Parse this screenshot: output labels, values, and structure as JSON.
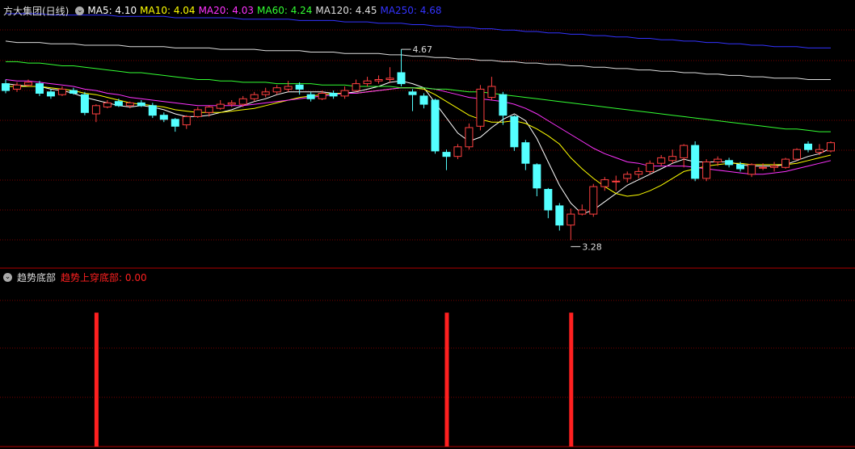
{
  "header": {
    "stock_name": "方大集团(日线)",
    "ma_labels": [
      {
        "text": "MA5: 4.10",
        "color": "#ffffff"
      },
      {
        "text": "MA10: 4.04",
        "color": "#ffff00"
      },
      {
        "text": "MA20: 4.03",
        "color": "#ff33ff"
      },
      {
        "text": "MA60: 4.24",
        "color": "#33ff33"
      },
      {
        "text": "MA120: 4.45",
        "color": "#dddddd"
      },
      {
        "text": "MA250: 4.68",
        "color": "#3333ff"
      }
    ]
  },
  "indicator": {
    "name": "趋势底部",
    "value_label": "趋势上穿底部: 0.00",
    "color": "#ff2020"
  },
  "colors": {
    "up": "#ff4040",
    "down": "#54ffff",
    "grid": "#7a0000",
    "divider": "#b00000"
  },
  "chart_data": [
    {
      "type": "candlestick",
      "title": "方大集团(日线)",
      "ylim": [
        3.1,
        4.9
      ],
      "high_marker": {
        "index": 35,
        "label": "4.67",
        "value": 4.67
      },
      "low_marker": {
        "index": 50,
        "label": "3.28",
        "value": 3.28
      },
      "candles": [
        {
          "o": 4.42,
          "c": 4.37,
          "h": 4.45,
          "l": 4.35
        },
        {
          "o": 4.38,
          "c": 4.41,
          "h": 4.43,
          "l": 4.36
        },
        {
          "o": 4.41,
          "c": 4.43,
          "h": 4.45,
          "l": 4.4
        },
        {
          "o": 4.42,
          "c": 4.35,
          "h": 4.44,
          "l": 4.33
        },
        {
          "o": 4.36,
          "c": 4.33,
          "h": 4.38,
          "l": 4.31
        },
        {
          "o": 4.34,
          "c": 4.38,
          "h": 4.4,
          "l": 4.33
        },
        {
          "o": 4.37,
          "c": 4.35,
          "h": 4.39,
          "l": 4.34
        },
        {
          "o": 4.34,
          "c": 4.21,
          "h": 4.36,
          "l": 4.19
        },
        {
          "o": 4.2,
          "c": 4.26,
          "h": 4.27,
          "l": 4.14
        },
        {
          "o": 4.25,
          "c": 4.28,
          "h": 4.3,
          "l": 4.24
        },
        {
          "o": 4.29,
          "c": 4.26,
          "h": 4.31,
          "l": 4.25
        },
        {
          "o": 4.26,
          "c": 4.28,
          "h": 4.29,
          "l": 4.24
        },
        {
          "o": 4.28,
          "c": 4.26,
          "h": 4.3,
          "l": 4.25
        },
        {
          "o": 4.26,
          "c": 4.19,
          "h": 4.28,
          "l": 4.17
        },
        {
          "o": 4.19,
          "c": 4.16,
          "h": 4.21,
          "l": 4.14
        },
        {
          "o": 4.16,
          "c": 4.11,
          "h": 4.17,
          "l": 4.07
        },
        {
          "o": 4.12,
          "c": 4.18,
          "h": 4.19,
          "l": 4.09
        },
        {
          "o": 4.18,
          "c": 4.23,
          "h": 4.25,
          "l": 4.17
        },
        {
          "o": 4.21,
          "c": 4.25,
          "h": 4.26,
          "l": 4.18
        },
        {
          "o": 4.24,
          "c": 4.27,
          "h": 4.3,
          "l": 4.23
        },
        {
          "o": 4.27,
          "c": 4.28,
          "h": 4.3,
          "l": 4.25
        },
        {
          "o": 4.27,
          "c": 4.31,
          "h": 4.33,
          "l": 4.25
        },
        {
          "o": 4.31,
          "c": 4.34,
          "h": 4.36,
          "l": 4.29
        },
        {
          "o": 4.34,
          "c": 4.36,
          "h": 4.39,
          "l": 4.32
        },
        {
          "o": 4.36,
          "c": 4.39,
          "h": 4.41,
          "l": 4.34
        },
        {
          "o": 4.38,
          "c": 4.4,
          "h": 4.44,
          "l": 4.36
        },
        {
          "o": 4.41,
          "c": 4.38,
          "h": 4.43,
          "l": 4.34
        },
        {
          "o": 4.34,
          "c": 4.31,
          "h": 4.36,
          "l": 4.29
        },
        {
          "o": 4.31,
          "c": 4.35,
          "h": 4.37,
          "l": 4.3
        },
        {
          "o": 4.35,
          "c": 4.33,
          "h": 4.37,
          "l": 4.31
        },
        {
          "o": 4.33,
          "c": 4.37,
          "h": 4.4,
          "l": 4.31
        },
        {
          "o": 4.37,
          "c": 4.42,
          "h": 4.45,
          "l": 4.36
        },
        {
          "o": 4.42,
          "c": 4.44,
          "h": 4.47,
          "l": 4.4
        },
        {
          "o": 4.44,
          "c": 4.45,
          "h": 4.48,
          "l": 4.42
        },
        {
          "o": 4.45,
          "c": 4.46,
          "h": 4.54,
          "l": 4.43
        },
        {
          "o": 4.5,
          "c": 4.42,
          "h": 4.67,
          "l": 4.4
        },
        {
          "o": 4.36,
          "c": 4.34,
          "h": 4.38,
          "l": 4.22
        },
        {
          "o": 4.33,
          "c": 4.27,
          "h": 4.35,
          "l": 4.24
        },
        {
          "o": 4.3,
          "c": 3.93,
          "h": 4.31,
          "l": 3.91
        },
        {
          "o": 3.92,
          "c": 3.89,
          "h": 3.94,
          "l": 3.79
        },
        {
          "o": 3.89,
          "c": 3.96,
          "h": 3.98,
          "l": 3.87
        },
        {
          "o": 3.96,
          "c": 4.1,
          "h": 4.13,
          "l": 3.94
        },
        {
          "o": 4.11,
          "c": 4.38,
          "h": 4.41,
          "l": 4.08
        },
        {
          "o": 4.32,
          "c": 4.4,
          "h": 4.47,
          "l": 4.3
        },
        {
          "o": 4.34,
          "c": 4.19,
          "h": 4.36,
          "l": 4.12
        },
        {
          "o": 4.18,
          "c": 3.96,
          "h": 4.19,
          "l": 3.93
        },
        {
          "o": 3.99,
          "c": 3.84,
          "h": 4.01,
          "l": 3.79
        },
        {
          "o": 3.83,
          "c": 3.66,
          "h": 3.84,
          "l": 3.6
        },
        {
          "o": 3.65,
          "c": 3.5,
          "h": 3.66,
          "l": 3.44
        },
        {
          "o": 3.53,
          "c": 3.39,
          "h": 3.55,
          "l": 3.35
        },
        {
          "o": 3.39,
          "c": 3.47,
          "h": 3.51,
          "l": 3.28
        },
        {
          "o": 3.47,
          "c": 3.5,
          "h": 3.54,
          "l": 3.46
        },
        {
          "o": 3.47,
          "c": 3.67,
          "h": 3.69,
          "l": 3.45
        },
        {
          "o": 3.67,
          "c": 3.72,
          "h": 3.74,
          "l": 3.64
        },
        {
          "o": 3.71,
          "c": 3.71,
          "h": 3.75,
          "l": 3.64
        },
        {
          "o": 3.73,
          "c": 3.76,
          "h": 3.78,
          "l": 3.7
        },
        {
          "o": 3.76,
          "c": 3.78,
          "h": 3.81,
          "l": 3.73
        },
        {
          "o": 3.78,
          "c": 3.84,
          "h": 3.86,
          "l": 3.76
        },
        {
          "o": 3.84,
          "c": 3.88,
          "h": 3.9,
          "l": 3.82
        },
        {
          "o": 3.86,
          "c": 3.89,
          "h": 3.94,
          "l": 3.84
        },
        {
          "o": 3.88,
          "c": 3.97,
          "h": 3.98,
          "l": 3.81
        },
        {
          "o": 3.97,
          "c": 3.73,
          "h": 4.0,
          "l": 3.71
        },
        {
          "o": 3.73,
          "c": 3.85,
          "h": 3.87,
          "l": 3.71
        },
        {
          "o": 3.85,
          "c": 3.87,
          "h": 3.89,
          "l": 3.82
        },
        {
          "o": 3.86,
          "c": 3.83,
          "h": 3.88,
          "l": 3.81
        },
        {
          "o": 3.83,
          "c": 3.8,
          "h": 3.85,
          "l": 3.78
        },
        {
          "o": 3.76,
          "c": 3.83,
          "h": 3.84,
          "l": 3.74
        },
        {
          "o": 3.81,
          "c": 3.81,
          "h": 3.84,
          "l": 3.79
        },
        {
          "o": 3.81,
          "c": 3.82,
          "h": 3.85,
          "l": 3.78
        },
        {
          "o": 3.81,
          "c": 3.87,
          "h": 3.88,
          "l": 3.8
        },
        {
          "o": 3.87,
          "c": 3.94,
          "h": 3.95,
          "l": 3.86
        },
        {
          "o": 3.98,
          "c": 3.94,
          "h": 4.0,
          "l": 3.92
        },
        {
          "o": 3.92,
          "c": 3.94,
          "h": 3.98,
          "l": 3.9
        },
        {
          "o": 3.93,
          "c": 3.99,
          "h": 4.0,
          "l": 3.92
        }
      ],
      "moving_averages": [
        {
          "name": "MA5",
          "color": "#ffffff",
          "values": [
            4.42,
            4.41,
            4.4,
            4.4,
            4.38,
            4.37,
            4.35,
            4.32,
            4.3,
            4.28,
            4.26,
            4.25,
            4.26,
            4.25,
            4.23,
            4.2,
            4.18,
            4.18,
            4.19,
            4.21,
            4.23,
            4.26,
            4.29,
            4.31,
            4.34,
            4.36,
            4.36,
            4.36,
            4.36,
            4.35,
            4.35,
            4.36,
            4.38,
            4.4,
            4.43,
            4.44,
            4.42,
            4.39,
            4.28,
            4.17,
            4.06,
            4.0,
            4.03,
            4.1,
            4.16,
            4.2,
            4.15,
            4.02,
            3.85,
            3.68,
            3.55,
            3.47,
            3.5,
            3.56,
            3.62,
            3.68,
            3.72,
            3.76,
            3.8,
            3.84,
            3.87,
            3.85,
            3.85,
            3.85,
            3.85,
            3.83,
            3.82,
            3.82,
            3.82,
            3.83,
            3.86,
            3.89,
            3.91,
            3.95
          ]
        },
        {
          "name": "MA10",
          "color": "#ffff00",
          "values": [
            4.4,
            4.4,
            4.4,
            4.4,
            4.39,
            4.38,
            4.37,
            4.35,
            4.34,
            4.32,
            4.3,
            4.28,
            4.27,
            4.26,
            4.25,
            4.23,
            4.22,
            4.21,
            4.21,
            4.21,
            4.22,
            4.23,
            4.24,
            4.26,
            4.28,
            4.3,
            4.32,
            4.33,
            4.34,
            4.35,
            4.35,
            4.35,
            4.36,
            4.37,
            4.38,
            4.39,
            4.39,
            4.38,
            4.34,
            4.29,
            4.24,
            4.19,
            4.16,
            4.14,
            4.14,
            4.15,
            4.13,
            4.09,
            4.04,
            3.98,
            3.88,
            3.8,
            3.73,
            3.67,
            3.62,
            3.6,
            3.61,
            3.64,
            3.68,
            3.73,
            3.78,
            3.8,
            3.82,
            3.83,
            3.84,
            3.84,
            3.83,
            3.83,
            3.83,
            3.83,
            3.84,
            3.86,
            3.88,
            3.9
          ]
        },
        {
          "name": "MA20",
          "color": "#ff33ff",
          "values": [
            4.45,
            4.44,
            4.44,
            4.43,
            4.42,
            4.41,
            4.4,
            4.38,
            4.37,
            4.35,
            4.34,
            4.32,
            4.31,
            4.3,
            4.29,
            4.28,
            4.27,
            4.26,
            4.26,
            4.26,
            4.26,
            4.26,
            4.27,
            4.28,
            4.29,
            4.3,
            4.31,
            4.32,
            4.33,
            4.34,
            4.35,
            4.35,
            4.36,
            4.37,
            4.38,
            4.39,
            4.39,
            4.39,
            4.38,
            4.36,
            4.34,
            4.32,
            4.31,
            4.3,
            4.29,
            4.27,
            4.24,
            4.2,
            4.15,
            4.1,
            4.05,
            4.0,
            3.95,
            3.91,
            3.88,
            3.85,
            3.84,
            3.82,
            3.82,
            3.82,
            3.82,
            3.81,
            3.8,
            3.79,
            3.78,
            3.77,
            3.76,
            3.76,
            3.77,
            3.78,
            3.8,
            3.82,
            3.84,
            3.86
          ]
        },
        {
          "name": "MA60",
          "color": "#33ff33",
          "values": [
            4.58,
            4.58,
            4.57,
            4.57,
            4.56,
            4.55,
            4.55,
            4.54,
            4.53,
            4.52,
            4.51,
            4.5,
            4.5,
            4.49,
            4.48,
            4.47,
            4.46,
            4.45,
            4.45,
            4.44,
            4.44,
            4.43,
            4.43,
            4.43,
            4.42,
            4.42,
            4.42,
            4.42,
            4.41,
            4.41,
            4.41,
            4.4,
            4.4,
            4.4,
            4.4,
            4.39,
            4.39,
            4.39,
            4.38,
            4.38,
            4.37,
            4.36,
            4.36,
            4.35,
            4.34,
            4.33,
            4.32,
            4.31,
            4.3,
            4.29,
            4.28,
            4.27,
            4.26,
            4.25,
            4.24,
            4.23,
            4.22,
            4.21,
            4.2,
            4.19,
            4.18,
            4.17,
            4.16,
            4.15,
            4.14,
            4.13,
            4.12,
            4.11,
            4.1,
            4.09,
            4.09,
            4.08,
            4.07,
            4.07
          ]
        },
        {
          "name": "MA120",
          "color": "#dddddd",
          "values": [
            4.73,
            4.72,
            4.72,
            4.72,
            4.71,
            4.71,
            4.71,
            4.7,
            4.7,
            4.7,
            4.7,
            4.69,
            4.69,
            4.69,
            4.69,
            4.68,
            4.68,
            4.68,
            4.68,
            4.67,
            4.67,
            4.67,
            4.67,
            4.66,
            4.66,
            4.66,
            4.66,
            4.65,
            4.65,
            4.65,
            4.64,
            4.64,
            4.64,
            4.64,
            4.63,
            4.63,
            4.62,
            4.62,
            4.61,
            4.61,
            4.6,
            4.6,
            4.59,
            4.59,
            4.58,
            4.58,
            4.57,
            4.57,
            4.56,
            4.56,
            4.55,
            4.55,
            4.54,
            4.54,
            4.53,
            4.53,
            4.52,
            4.52,
            4.51,
            4.51,
            4.5,
            4.5,
            4.49,
            4.49,
            4.48,
            4.48,
            4.47,
            4.47,
            4.46,
            4.46,
            4.46,
            4.45,
            4.45,
            4.45
          ]
        },
        {
          "name": "MA250",
          "color": "#3333ff",
          "values": [
            4.93,
            4.93,
            4.93,
            4.93,
            4.92,
            4.92,
            4.92,
            4.92,
            4.92,
            4.92,
            4.91,
            4.91,
            4.91,
            4.91,
            4.91,
            4.9,
            4.9,
            4.9,
            4.9,
            4.9,
            4.9,
            4.89,
            4.89,
            4.89,
            4.89,
            4.89,
            4.88,
            4.88,
            4.88,
            4.88,
            4.87,
            4.87,
            4.87,
            4.86,
            4.86,
            4.86,
            4.85,
            4.85,
            4.84,
            4.84,
            4.83,
            4.83,
            4.82,
            4.82,
            4.81,
            4.81,
            4.8,
            4.8,
            4.79,
            4.79,
            4.78,
            4.78,
            4.77,
            4.77,
            4.76,
            4.76,
            4.75,
            4.75,
            4.74,
            4.74,
            4.73,
            4.73,
            4.72,
            4.72,
            4.71,
            4.71,
            4.7,
            4.7,
            4.69,
            4.69,
            4.69,
            4.68,
            4.68,
            4.68
          ]
        }
      ]
    },
    {
      "type": "bar",
      "title": "趋势底部",
      "signal_indices": [
        8,
        39,
        50
      ],
      "values_at_signal": 1,
      "ylim": [
        0,
        1.2
      ]
    }
  ]
}
